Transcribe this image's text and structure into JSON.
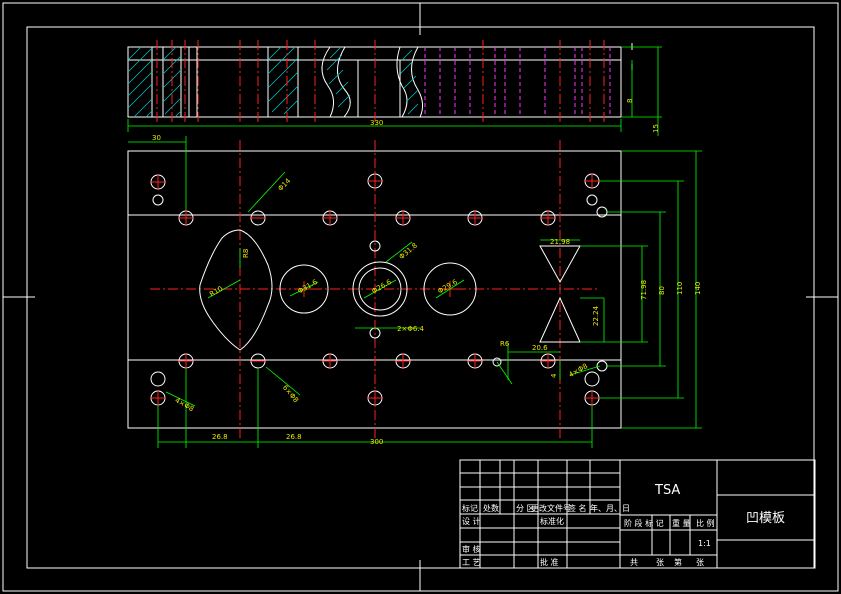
{
  "title_block": {
    "code": "TSA",
    "part_name": "凹模板",
    "scale": "1:1",
    "rev_headers": [
      "标记",
      "处数",
      "分 区",
      "更改文件号",
      "签 名",
      "年、月、日"
    ],
    "design": "设 计",
    "standardize": "标准化",
    "stage_mark": "阶 段 标 记",
    "weight": "重 量",
    "scale_label": "比 例",
    "audit": "审 核",
    "process": "工 艺",
    "approve": "批 准",
    "sheets_total": "共",
    "sheets_unit": "张",
    "sheet_no": "第",
    "sheet_unit2": "张"
  },
  "dims": {
    "overall_length": "330",
    "left_offset": "30",
    "height_side": "8",
    "thickness": "15",
    "spacing_1": "26.8",
    "spacing_2": "26.8",
    "bottom_total": "300",
    "right_h1": "71.98",
    "right_h2": "80",
    "right_h3": "110",
    "right_total": "140",
    "hole_dia_1": "Φ14",
    "hole_r_top": "R8",
    "hole_r_side": "R10",
    "circle_1": "Φ31.6",
    "circle_2": "Φ26.6",
    "circle_3": "Φ31.8",
    "circle_4": "Φ29.6",
    "small_hole": "2×Φ6.4",
    "tri_top": "21.98",
    "tri_side": "22.24",
    "tri_bottom": "20.6",
    "r_small": "R6",
    "bolt_1": "6×Φ8",
    "bolt_2": "4×Φ8",
    "bolt_3": "4×Φ8",
    "dim_4": "4"
  }
}
